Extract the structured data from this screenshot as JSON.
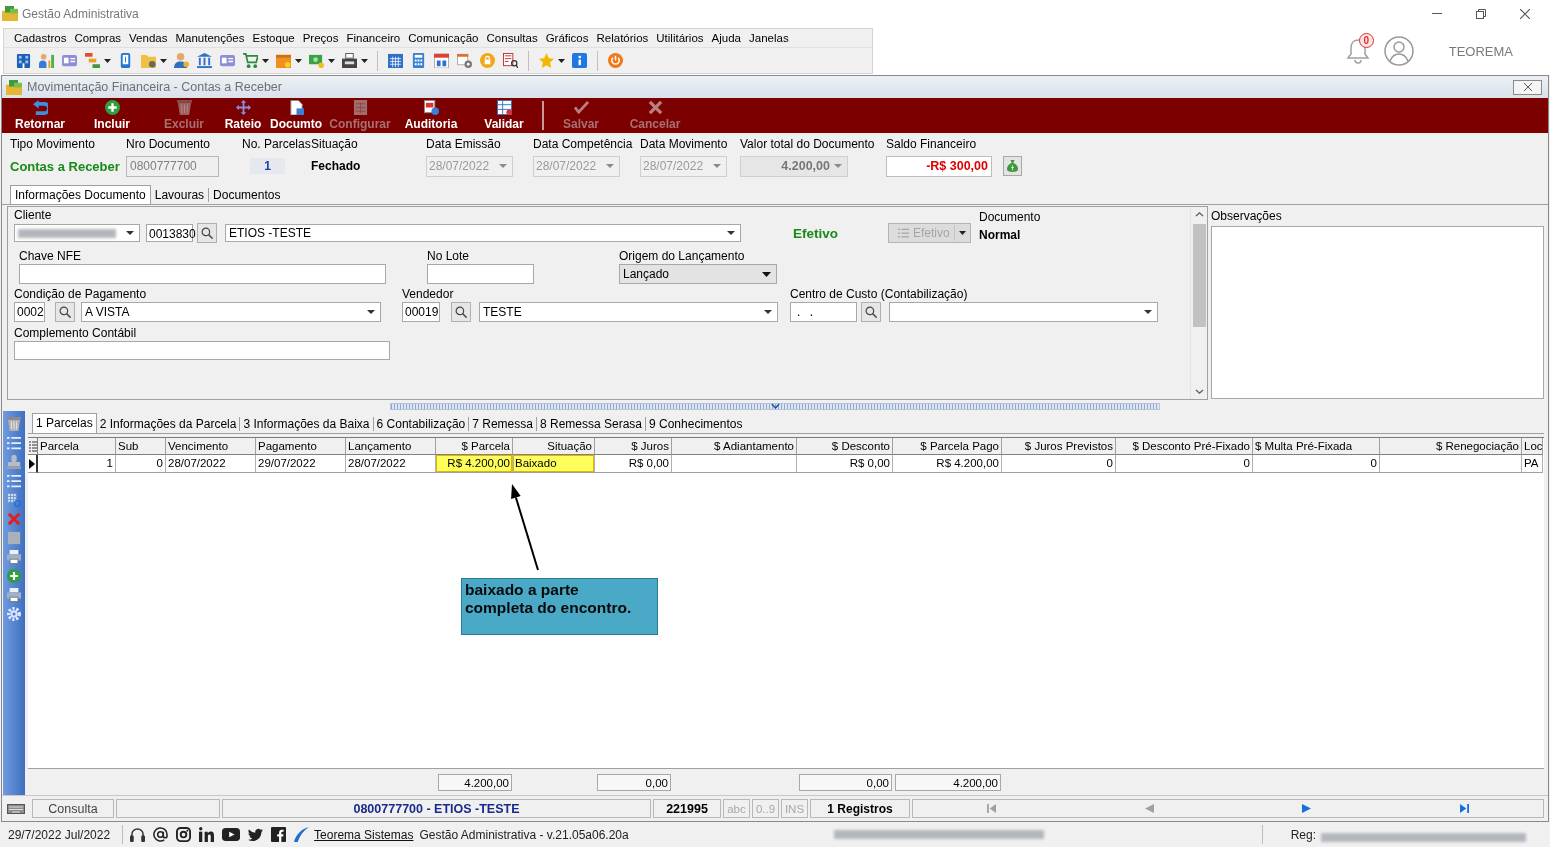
{
  "app_window": {
    "title": "Gestão Administrativa"
  },
  "menu": [
    "Cadastros",
    "Compras",
    "Vendas",
    "Manutenções",
    "Estoque",
    "Preços",
    "Financeiro",
    "Comunicação",
    "Consultas",
    "Gráficos",
    "Relatórios",
    "Utilitários",
    "Ajuda",
    "Janelas"
  ],
  "notifications": {
    "count": "0"
  },
  "user": {
    "name": "TEOREMA"
  },
  "child_window": {
    "title": "Movimentação Financeira - Contas a Receber"
  },
  "action_groups": [
    {
      "items": [
        {
          "label": "Retornar",
          "disabled": false
        },
        {
          "label": "Incluir",
          "disabled": false
        },
        {
          "label": "Excluir",
          "disabled": true
        },
        {
          "label": "Rateio",
          "disabled": false
        },
        {
          "label": "Documto",
          "disabled": false
        },
        {
          "label": "Configurar",
          "disabled": true
        },
        {
          "label": "Auditoria",
          "disabled": false
        },
        {
          "label": "Validar",
          "disabled": false
        }
      ]
    },
    {
      "items": [
        {
          "label": "Salvar",
          "disabled": true
        },
        {
          "label": "Cancelar",
          "disabled": true
        }
      ]
    }
  ],
  "header": {
    "fields": [
      {
        "label": "Tipo Movimento",
        "kind": "emphasis",
        "value": "Contas a Receber",
        "disabled": false
      },
      {
        "label": "Nro Documento",
        "kind": "input",
        "value": "0800777700",
        "disabled": true
      },
      {
        "label": "No. Parcelas",
        "kind": "count",
        "value": "1",
        "disabled": false
      },
      {
        "label": "Situação",
        "kind": "text",
        "value": "Fechado",
        "disabled": false
      },
      {
        "label": "Data Emissão",
        "kind": "combo",
        "value": "28/07/2022",
        "disabled": true
      },
      {
        "label": "Data Competência",
        "kind": "combo",
        "value": "28/07/2022",
        "disabled": true
      },
      {
        "label": "Data Movimento",
        "kind": "combo",
        "value": "28/07/2022",
        "disabled": true
      },
      {
        "label": "Valor total do Documento",
        "kind": "amount",
        "value": "4.200,00",
        "disabled": true
      },
      {
        "label": "Saldo Financeiro",
        "kind": "balance",
        "value": "-R$ 300,00",
        "disabled": false
      }
    ]
  },
  "tabs": [
    {
      "label": "Informações Documento",
      "selected": true
    },
    {
      "label": "Lavouras",
      "selected": false
    },
    {
      "label": "Documentos",
      "selected": false
    }
  ],
  "form": {
    "cliente": {
      "label": "Cliente",
      "code": "0013830",
      "name": "ETIOS -TESTE"
    },
    "status": {
      "text": "Efetivo"
    },
    "status_button": {
      "label": "Efetivo",
      "disabled": true
    },
    "documento": {
      "label": "Documento",
      "value": "Normal"
    },
    "chave_nfe": {
      "label": "Chave NFE"
    },
    "no_lote": {
      "label": "No Lote"
    },
    "origem": {
      "label": "Origem do Lançamento",
      "value": "Lançado"
    },
    "condicao_pagamento": {
      "label": "Condição de Pagamento",
      "code": "0002",
      "name": "A VISTA"
    },
    "vendedor": {
      "label": "Vendedor",
      "code": "00019",
      "name": "TESTE"
    },
    "centro_custo": {
      "label": "Centro de Custo (Contabilização)",
      "code": ". ."
    },
    "complemento": {
      "label": "Complemento Contábil"
    }
  },
  "observacoes": {
    "label": "Observações"
  },
  "detail_tabs": [
    {
      "label": "1 Parcelas",
      "selected": true
    },
    {
      "label": "2 Informações da Parcela",
      "selected": false
    },
    {
      "label": "3 Informações da Baixa",
      "selected": false
    },
    {
      "label": "6 Contabilização",
      "selected": false
    },
    {
      "label": "7 Remessa",
      "selected": false
    },
    {
      "label": "8 Remessa Serasa",
      "selected": false
    },
    {
      "label": "9 Conhecimentos",
      "selected": false
    }
  ],
  "grid": {
    "columns": [
      {
        "label": "Parcela"
      },
      {
        "label": "Sub"
      },
      {
        "label": "Vencimento"
      },
      {
        "label": "Pagamento"
      },
      {
        "label": "Lançamento"
      },
      {
        "label": "$ Parcela",
        "total": "4.200,00"
      },
      {
        "label": "Situação"
      },
      {
        "label": "$ Juros",
        "total": "0,00"
      },
      {
        "label": "$ Adiantamento"
      },
      {
        "label": "$ Desconto",
        "total": "0,00"
      },
      {
        "label": "$ Parcela Pago",
        "total": "4.200,00"
      },
      {
        "label": "$ Juros Previstos"
      },
      {
        "label": "$ Desconto Pré-Fixado"
      },
      {
        "label": "$ Multa Pré-Fixada"
      },
      {
        "label": "$ Renegociação"
      },
      {
        "label": "Loc"
      }
    ],
    "rows": [
      {
        "selected": true,
        "cells": [
          {
            "text": "1",
            "highlighted": false
          },
          {
            "text": "0",
            "highlighted": false
          },
          {
            "text": "28/07/2022",
            "highlighted": false
          },
          {
            "text": "29/07/2022",
            "highlighted": false
          },
          {
            "text": "28/07/2022",
            "highlighted": false
          },
          {
            "text": "R$ 4.200,00",
            "highlighted": true
          },
          {
            "text": "Baixado",
            "highlighted": true
          },
          {
            "text": "R$ 0,00",
            "highlighted": false
          },
          {
            "highlighted": false
          },
          {
            "text": "R$ 0,00",
            "highlighted": false
          },
          {
            "text": "R$ 4.200,00",
            "highlighted": false
          },
          {
            "text": "0",
            "highlighted": false
          },
          {
            "text": "0",
            "highlighted": false
          },
          {
            "text": "0",
            "highlighted": false
          },
          {
            "highlighted": false
          },
          {
            "text": "PA",
            "highlighted": false
          }
        ]
      }
    ]
  },
  "annotation": {
    "lines": [
      "baixado a parte",
      "completa do encontro."
    ]
  },
  "status_bar": {
    "mode": "Consulta",
    "record": "0800777700 - ETIOS -TESTE",
    "code": "221995",
    "indicators": [
      {
        "label": "abc",
        "on": false
      },
      {
        "label": "0..9",
        "on": false
      },
      {
        "label": "INS",
        "on": false
      }
    ],
    "count": "1 Registros",
    "navigation": [
      {
        "kind": "first",
        "disabled": true
      },
      {
        "kind": "previous",
        "disabled": true
      },
      {
        "kind": "next",
        "disabled": false
      },
      {
        "kind": "last",
        "disabled": false
      }
    ]
  },
  "footer": {
    "date": "29/7/2022 Jul/2022",
    "link": "Teorema Sistemas",
    "version": "Gestão Administrativa - v.21.05a06.20a",
    "registration_label": "Reg:"
  }
}
